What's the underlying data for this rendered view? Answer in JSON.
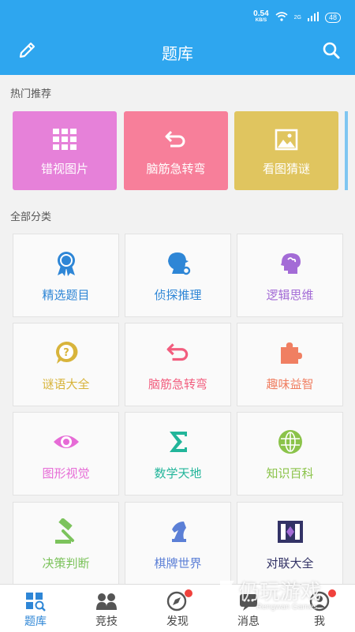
{
  "status_bar": {
    "speed_value": "0.54",
    "speed_unit": "KB/S",
    "network": "2G",
    "battery": "48"
  },
  "header": {
    "title": "题库",
    "edit_icon": "edit-icon",
    "search_icon": "search-icon"
  },
  "hot_section": {
    "label": "热门推荐",
    "items": [
      {
        "label": "错视图片",
        "icon": "grid-icon",
        "color": "#e681d9"
      },
      {
        "label": "脑筋急转弯",
        "icon": "undo-arrow-icon",
        "color": "#f77f9a"
      },
      {
        "label": "看图猜谜",
        "icon": "image-icon",
        "color": "#e0c55f"
      }
    ]
  },
  "all_section": {
    "label": "全部分类",
    "items": [
      {
        "label": "精选题目",
        "icon": "award-ribbon-icon",
        "color": "#2e86d6"
      },
      {
        "label": "侦探推理",
        "icon": "detective-icon",
        "color": "#2e86d6"
      },
      {
        "label": "逻辑思维",
        "icon": "brain-head-icon",
        "color": "#a36bd6"
      },
      {
        "label": "谜语大全",
        "icon": "question-bubble-icon",
        "color": "#d8b43b"
      },
      {
        "label": "脑筋急转弯",
        "icon": "undo-arrow-icon",
        "color": "#f25d7e"
      },
      {
        "label": "趣味益智",
        "icon": "puzzle-icon",
        "color": "#f07f62"
      },
      {
        "label": "图形视觉",
        "icon": "eye-icon",
        "color": "#e66bd6"
      },
      {
        "label": "数学天地",
        "icon": "sigma-icon",
        "color": "#22b59a"
      },
      {
        "label": "知识百科",
        "icon": "globe-icon",
        "color": "#8bc34a"
      },
      {
        "label": "决策判断",
        "icon": "gavel-icon",
        "color": "#7cc35c"
      },
      {
        "label": "棋牌世界",
        "icon": "chess-knight-icon",
        "color": "#5b7fd6"
      },
      {
        "label": "对联大全",
        "icon": "couplet-icon",
        "color": "#333366"
      }
    ]
  },
  "tabbar": {
    "items": [
      {
        "label": "题库",
        "icon": "library-search-icon",
        "active": true
      },
      {
        "label": "竞技",
        "icon": "compete-icon",
        "active": false
      },
      {
        "label": "发现",
        "icon": "compass-icon",
        "active": false
      },
      {
        "label": "消息",
        "icon": "message-icon",
        "active": false
      },
      {
        "label": "我",
        "icon": "profile-icon",
        "active": false
      }
    ]
  },
  "watermark": {
    "text": "仍玩游戏",
    "subtext": "Rengwan Games"
  },
  "colors": {
    "primary": "#2ea6ef",
    "active_tab": "#2e86d6",
    "badge": "#f0413c"
  }
}
